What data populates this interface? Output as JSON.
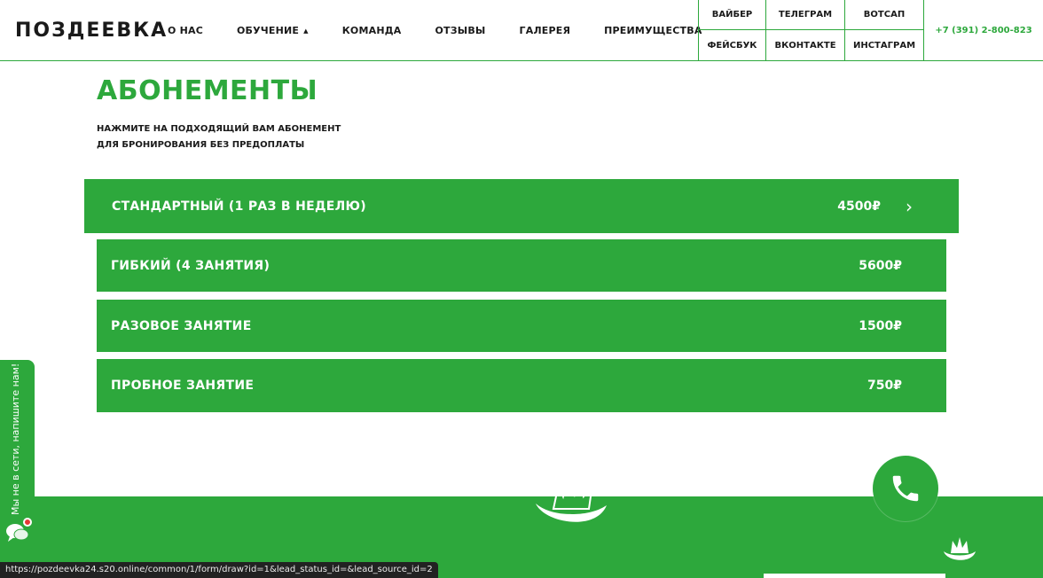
{
  "header": {
    "logo": "ПОЗДЕЕВКА",
    "nav": [
      {
        "label": "О НАС",
        "has_caret": false
      },
      {
        "label": "ОБУЧЕНИЕ",
        "has_caret": true
      },
      {
        "label": "КОМАНДА",
        "has_caret": false
      },
      {
        "label": "ОТЗЫВЫ",
        "has_caret": false
      },
      {
        "label": "ГАЛЕРЕЯ",
        "has_caret": false
      },
      {
        "label": "ПРЕИМУЩЕСТВА",
        "has_caret": false
      }
    ],
    "socials": [
      "ВАЙБЕР",
      "ТЕЛЕГРАМ",
      "ВОТСАП",
      "ФЕЙСБУК",
      "ВКОНТАКТЕ",
      "ИНСТАГРАМ"
    ],
    "phone": "+7 (391) 2-800-823"
  },
  "main": {
    "title": "АБОНЕМЕНТЫ",
    "subtitle_line1": "НАЖМИТЕ НА ПОДХОДЯЩИЙ ВАМ АБОНЕМЕНТ",
    "subtitle_line2": "ДЛЯ БРОНИРОВАНИЯ БЕЗ ПРЕДОПЛАТЫ",
    "tariffs": [
      {
        "name": "СТАНДАРТНЫЙ (1 РАЗ В НЕДЕЛЮ)",
        "price": "4500₽",
        "arrow": "›"
      },
      {
        "name": "ГИБКИЙ (4 ЗАНЯТИЯ)",
        "price": "5600₽"
      },
      {
        "name": "РАЗОВОЕ ЗАНЯТИЕ",
        "price": "1500₽"
      },
      {
        "name": "ПРОБНОЕ ЗАНЯТИЕ",
        "price": "750₽"
      }
    ]
  },
  "chat": {
    "text": "Мы не в сети, напишите нам!"
  },
  "status_bar": {
    "url": "https://pozdeevka24.s20.online/common/1/form/draw?id=1&lead_status_id=&lead_source_id=2"
  },
  "colors": {
    "accent": "#2da83c",
    "text": "#1a1a1a",
    "badge": "#e53935"
  }
}
